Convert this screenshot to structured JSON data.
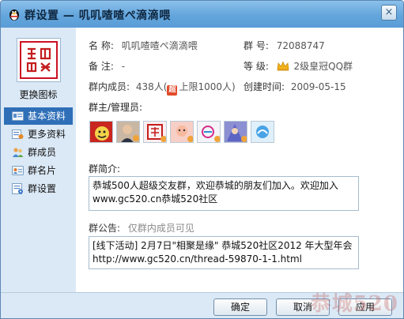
{
  "window": {
    "title": "群设置 — 叽叽喳喳ぺ滴滴喂",
    "close_glyph": "×"
  },
  "sidebar": {
    "change_icon_label": "更换图标",
    "items": [
      {
        "label": "基本资料",
        "icon": "info-card-icon",
        "selected": true
      },
      {
        "label": "更多资料",
        "icon": "more-info-icon",
        "selected": false
      },
      {
        "label": "群成员",
        "icon": "members-icon",
        "selected": false
      },
      {
        "label": "群名片",
        "icon": "name-card-icon",
        "selected": false
      },
      {
        "label": "群设置",
        "icon": "settings-icon",
        "selected": false
      }
    ]
  },
  "info": {
    "name_label": "名  称:",
    "name_value": "叽叽喳喳ぺ滴滴喂",
    "number_label": "群  号:",
    "number_value": "72088747",
    "note_label": "备  注:",
    "note_value": "-",
    "level_label": "等  级:",
    "level_value": "2级皇冠QQ群",
    "members_label": "群内成员:",
    "members_value_prefix": "438人(",
    "members_badge": "超",
    "members_value_suffix": "上限1000人)",
    "created_label": "创建时间:",
    "created_value": "2009-05-15",
    "admins_label": "群主/管理员:",
    "intro_label": "群简介:",
    "intro_line1": "恭城500人超级交友群，欢迎恭城的朋友们加入。欢迎加入",
    "intro_line2": "www.gc520.cn恭城520社区",
    "notice_label": "群公告:",
    "notice_hint": "仅群内成员可见",
    "notice_line1": "[线下活动] 2月7日\"相聚是缘\" 恭城520社区2012 年大型年会",
    "notice_line2": "http://www.gc520.cn/thread-59870-1-1.html"
  },
  "footer": {
    "ok_label": "确定",
    "cancel_label": "取消",
    "apply_label": "应用",
    "watermark": "恭城520"
  },
  "colors": {
    "accent": "#2f6fb8",
    "titlebar": "#63a5dc",
    "sidebar_bg": "#dbe9f6"
  }
}
